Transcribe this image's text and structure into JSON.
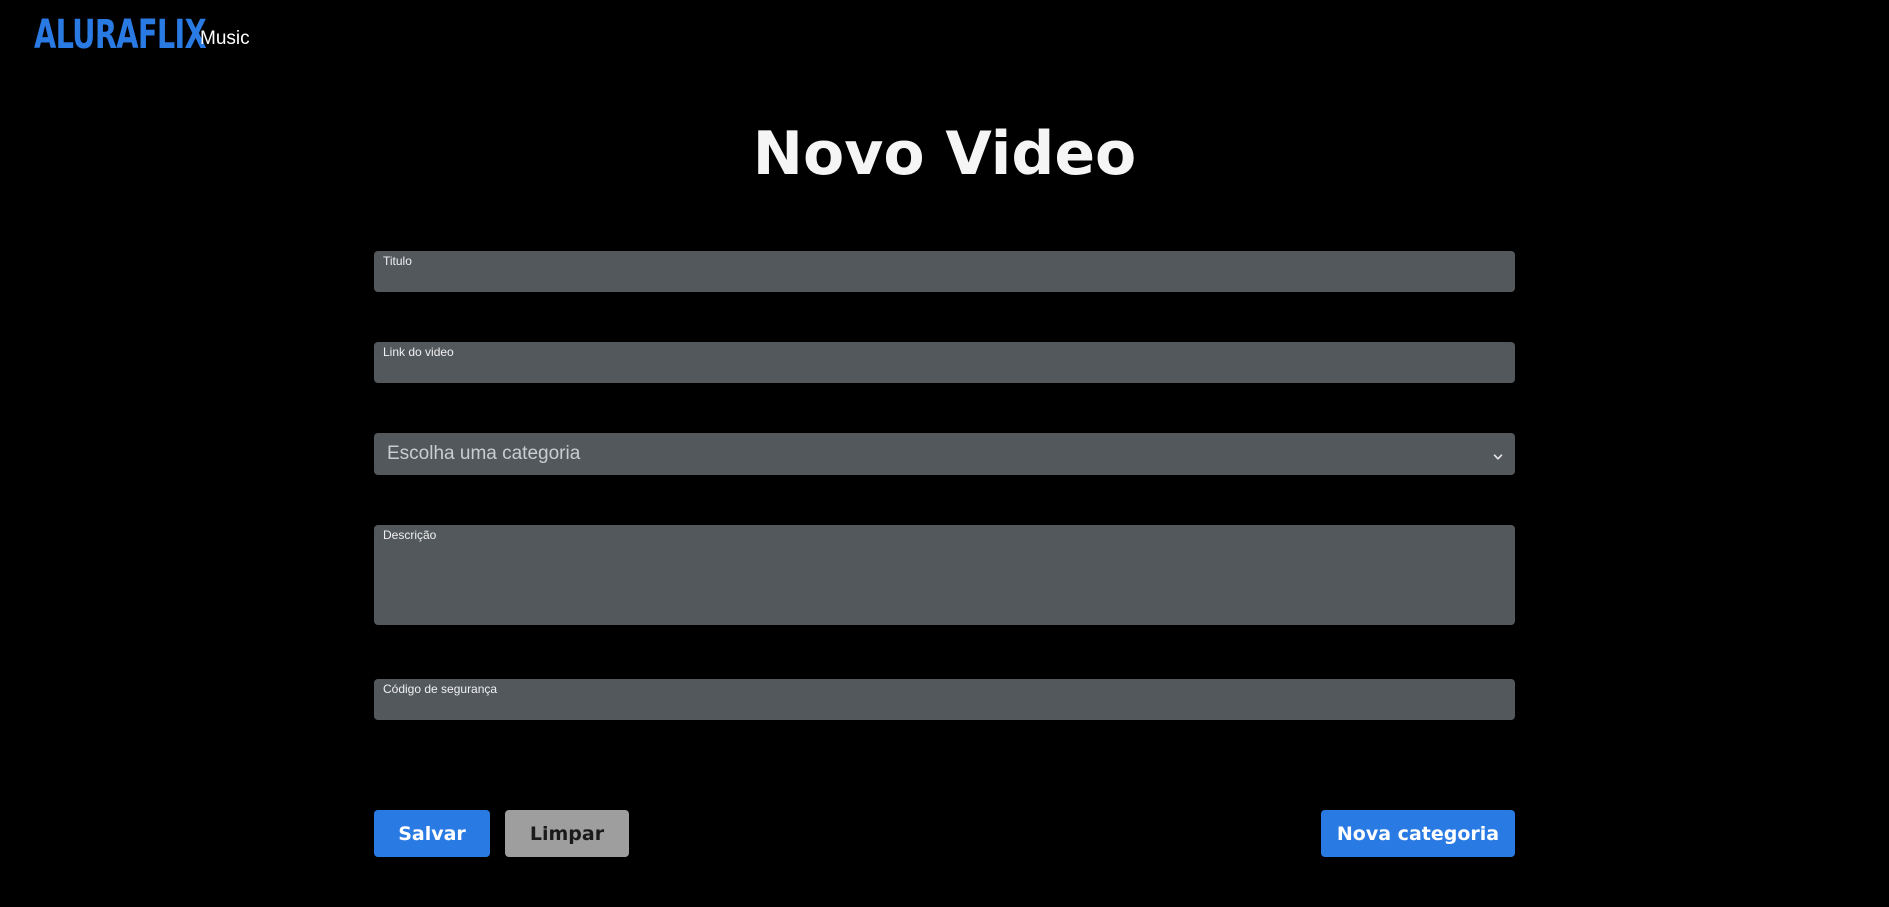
{
  "header": {
    "brand": "ALURAFLIX",
    "brand_sub": "Music"
  },
  "page": {
    "title": "Novo Video"
  },
  "form": {
    "titulo": {
      "label": "Titulo",
      "value": ""
    },
    "link": {
      "label": "Link do video",
      "value": ""
    },
    "categoria": {
      "selected": "Escolha uma categoria"
    },
    "descricao": {
      "label": "Descrição",
      "value": ""
    },
    "codigo": {
      "label": "Código de segurança",
      "value": ""
    }
  },
  "actions": {
    "save_label": "Salvar",
    "clear_label": "Limpar",
    "new_category_label": "Nova categoria"
  },
  "colors": {
    "background": "#000000",
    "brand": "#2a7ae4",
    "field_bg": "#53585d",
    "clear_button": "#9e9e9e"
  }
}
